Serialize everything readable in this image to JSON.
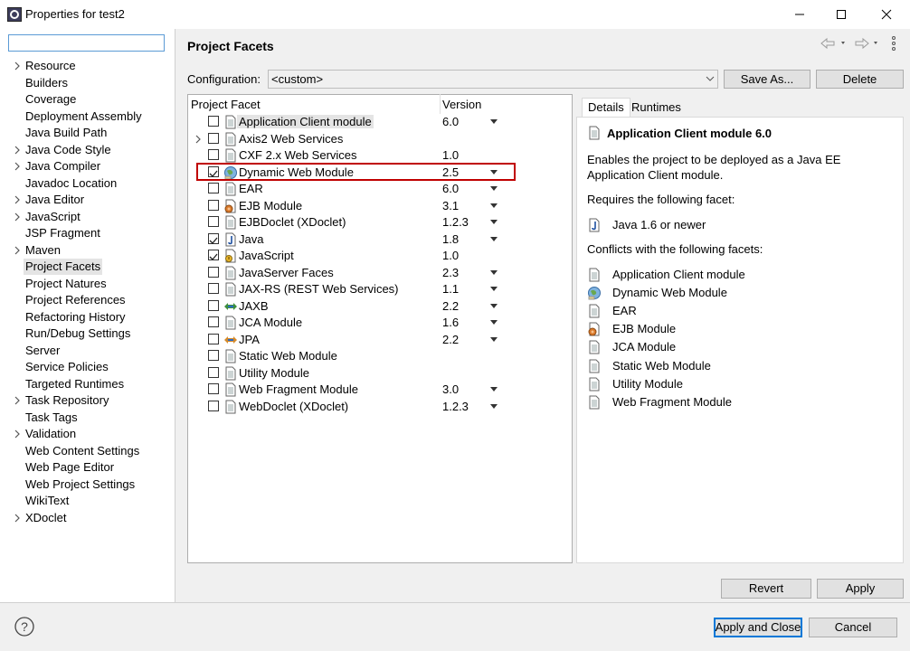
{
  "window": {
    "title": "Properties for test2"
  },
  "tree": {
    "items": [
      {
        "label": "Resource",
        "expandable": true
      },
      {
        "label": "Builders",
        "expandable": false
      },
      {
        "label": "Coverage",
        "expandable": false
      },
      {
        "label": "Deployment Assembly",
        "expandable": false
      },
      {
        "label": "Java Build Path",
        "expandable": false
      },
      {
        "label": "Java Code Style",
        "expandable": true
      },
      {
        "label": "Java Compiler",
        "expandable": true
      },
      {
        "label": "Javadoc Location",
        "expandable": false
      },
      {
        "label": "Java Editor",
        "expandable": true
      },
      {
        "label": "JavaScript",
        "expandable": true
      },
      {
        "label": "JSP Fragment",
        "expandable": false
      },
      {
        "label": "Maven",
        "expandable": true
      },
      {
        "label": "Project Facets",
        "expandable": false,
        "selected": true
      },
      {
        "label": "Project Natures",
        "expandable": false
      },
      {
        "label": "Project References",
        "expandable": false
      },
      {
        "label": "Refactoring History",
        "expandable": false
      },
      {
        "label": "Run/Debug Settings",
        "expandable": false
      },
      {
        "label": "Server",
        "expandable": false
      },
      {
        "label": "Service Policies",
        "expandable": false
      },
      {
        "label": "Targeted Runtimes",
        "expandable": false
      },
      {
        "label": "Task Repository",
        "expandable": true
      },
      {
        "label": "Task Tags",
        "expandable": false
      },
      {
        "label": "Validation",
        "expandable": true
      },
      {
        "label": "Web Content Settings",
        "expandable": false
      },
      {
        "label": "Web Page Editor",
        "expandable": false
      },
      {
        "label": "Web Project Settings",
        "expandable": false
      },
      {
        "label": "WikiText",
        "expandable": false
      },
      {
        "label": "XDoclet",
        "expandable": true
      }
    ]
  },
  "page": {
    "title": "Project Facets"
  },
  "configuration": {
    "label": "Configuration:",
    "value": "<custom>",
    "save_as": "Save As...",
    "delete": "Delete"
  },
  "facets": {
    "header_facet": "Project Facet",
    "header_version": "Version",
    "rows": [
      {
        "name": "Application Client module",
        "version": "6.0",
        "checked": false,
        "dropdown": true,
        "icon": "page-icon",
        "highlight": true
      },
      {
        "name": "Axis2 Web Services",
        "version": "",
        "checked": false,
        "dropdown": false,
        "icon": "page-icon",
        "expandable": true
      },
      {
        "name": "CXF 2.x Web Services",
        "version": "1.0",
        "checked": false,
        "dropdown": false,
        "icon": "page-icon"
      },
      {
        "name": "Dynamic Web Module",
        "version": "2.5",
        "checked": true,
        "dropdown": true,
        "icon": "globe-icon"
      },
      {
        "name": "EAR",
        "version": "6.0",
        "checked": false,
        "dropdown": true,
        "icon": "page-icon"
      },
      {
        "name": "EJB Module",
        "version": "3.1",
        "checked": false,
        "dropdown": true,
        "icon": "bean-icon"
      },
      {
        "name": "EJBDoclet (XDoclet)",
        "version": "1.2.3",
        "checked": false,
        "dropdown": true,
        "icon": "page-icon"
      },
      {
        "name": "Java",
        "version": "1.8",
        "checked": true,
        "dropdown": true,
        "icon": "java-icon"
      },
      {
        "name": "JavaScript",
        "version": "1.0",
        "checked": true,
        "dropdown": false,
        "icon": "javascript-icon"
      },
      {
        "name": "JavaServer Faces",
        "version": "2.3",
        "checked": false,
        "dropdown": true,
        "icon": "page-icon"
      },
      {
        "name": "JAX-RS (REST Web Services)",
        "version": "1.1",
        "checked": false,
        "dropdown": true,
        "icon": "page-icon"
      },
      {
        "name": "JAXB",
        "version": "2.2",
        "checked": false,
        "dropdown": true,
        "icon": "arrows-icon"
      },
      {
        "name": "JCA Module",
        "version": "1.6",
        "checked": false,
        "dropdown": true,
        "icon": "page-icon"
      },
      {
        "name": "JPA",
        "version": "2.2",
        "checked": false,
        "dropdown": true,
        "icon": "jpa-icon"
      },
      {
        "name": "Static Web Module",
        "version": "",
        "checked": false,
        "dropdown": false,
        "icon": "page-icon"
      },
      {
        "name": "Utility Module",
        "version": "",
        "checked": false,
        "dropdown": false,
        "icon": "page-icon"
      },
      {
        "name": "Web Fragment Module",
        "version": "3.0",
        "checked": false,
        "dropdown": true,
        "icon": "page-icon"
      },
      {
        "name": "WebDoclet (XDoclet)",
        "version": "1.2.3",
        "checked": false,
        "dropdown": true,
        "icon": "page-icon"
      }
    ]
  },
  "details": {
    "tabs": [
      "Details",
      "Runtimes"
    ],
    "heading": "Application Client module 6.0",
    "description_line1": "Enables the project to be deployed as a Java EE",
    "description_line2": "Application Client module.",
    "requires_label": "Requires the following facet:",
    "requires": [
      {
        "label": "Java 1.6 or newer",
        "icon": "java-icon"
      }
    ],
    "conflicts_label": "Conflicts with the following facets:",
    "conflicts": [
      {
        "label": "Application Client module",
        "icon": "page-icon"
      },
      {
        "label": "Dynamic Web Module",
        "icon": "globe-icon"
      },
      {
        "label": "EAR",
        "icon": "page-icon"
      },
      {
        "label": "EJB Module",
        "icon": "bean-icon"
      },
      {
        "label": "JCA Module",
        "icon": "page-icon"
      },
      {
        "label": "Static Web Module",
        "icon": "page-icon"
      },
      {
        "label": "Utility Module",
        "icon": "page-icon"
      },
      {
        "label": "Web Fragment Module",
        "icon": "page-icon"
      }
    ]
  },
  "buttons": {
    "revert": "Revert",
    "apply": "Apply",
    "apply_close": "Apply and Close",
    "cancel": "Cancel"
  }
}
